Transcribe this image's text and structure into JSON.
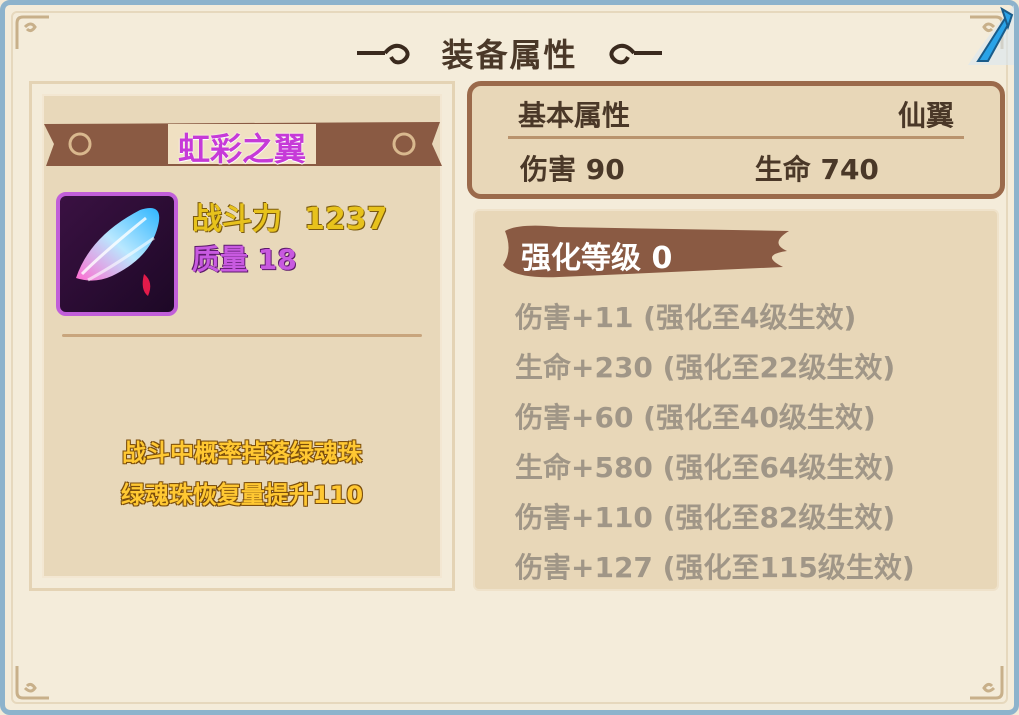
{
  "dialog": {
    "title": "装备属性"
  },
  "item": {
    "name": "虹彩之翼",
    "power_label": "战斗力",
    "power_value": "1237",
    "quality_label": "质量 18",
    "description_lines": [
      "战斗中概率掉落绿魂珠",
      "绿魂珠恢复量提升110"
    ]
  },
  "basic": {
    "header_label": "基本属性",
    "type": "仙翼",
    "damage": "伤害 90",
    "life": "生命 740"
  },
  "enhance": {
    "label": "强化等级 0",
    "items": [
      "伤害+11 (强化至4级生效)",
      "生命+230 (强化至22级生效)",
      "伤害+60 (强化至40级生效)",
      "生命+580 (强化至64级生效)",
      "伤害+110 (强化至82级生效)",
      "伤害+127 (强化至115级生效)"
    ]
  },
  "colors": {
    "frame_border": "#8db3cc",
    "item_name": "#c63ad8",
    "power": "#e7c21c",
    "banner": "#8a5a43",
    "inactive_text": "#a09687"
  },
  "icons": {
    "item": "rainbow-wings-icon",
    "close": "close-icon"
  }
}
